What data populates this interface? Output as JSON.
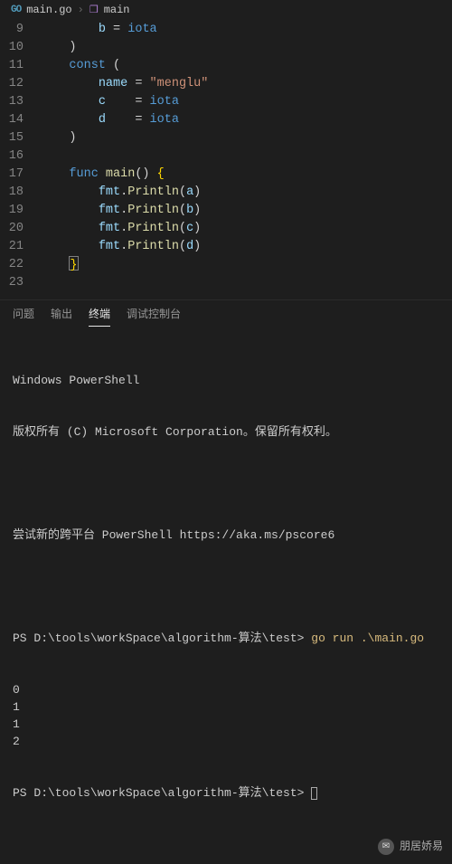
{
  "breadcrumb": {
    "file": "main.go",
    "symbol": "main"
  },
  "code_lines": [
    {
      "n": 9,
      "html": "        <span class='tok-id'>b</span> <span class='tok-punc'>=</span> <span class='tok-iota'>iota</span>"
    },
    {
      "n": 10,
      "html": "    <span class='tok-punc'>)</span>"
    },
    {
      "n": 11,
      "html": "    <span class='tok-kw'>const</span> <span class='tok-punc'>(</span>"
    },
    {
      "n": 12,
      "html": "        <span class='tok-id'>name</span> <span class='tok-punc'>=</span> <span class='tok-str'>\"menglu\"</span>"
    },
    {
      "n": 13,
      "html": "        <span class='tok-id'>c</span>    <span class='tok-punc'>=</span> <span class='tok-iota'>iota</span>"
    },
    {
      "n": 14,
      "html": "        <span class='tok-id'>d</span>    <span class='tok-punc'>=</span> <span class='tok-iota'>iota</span>"
    },
    {
      "n": 15,
      "html": "    <span class='tok-punc'>)</span>"
    },
    {
      "n": 16,
      "html": ""
    },
    {
      "n": 17,
      "html": "    <span class='tok-kw'>func</span> <span class='tok-func'>main</span><span class='tok-punc'>()</span> <span class='tok-brace'>{</span>"
    },
    {
      "n": 18,
      "html": "        <span class='tok-id'>fmt</span><span class='tok-punc'>.</span><span class='tok-func'>Println</span><span class='tok-punc'>(</span><span class='tok-id'>a</span><span class='tok-punc'>)</span>"
    },
    {
      "n": 19,
      "html": "        <span class='tok-id'>fmt</span><span class='tok-punc'>.</span><span class='tok-func'>Println</span><span class='tok-punc'>(</span><span class='tok-id'>b</span><span class='tok-punc'>)</span>"
    },
    {
      "n": 20,
      "html": "        <span class='tok-id'>fmt</span><span class='tok-punc'>.</span><span class='tok-func'>Println</span><span class='tok-punc'>(</span><span class='tok-id'>c</span><span class='tok-punc'>)</span>"
    },
    {
      "n": 21,
      "html": "        <span class='tok-id'>fmt</span><span class='tok-punc'>.</span><span class='tok-func'>Println</span><span class='tok-punc'>(</span><span class='tok-id'>d</span><span class='tok-punc'>)</span>"
    },
    {
      "n": 22,
      "html": "    <span class='cursor-box'><span class='tok-brace'>}</span></span>"
    },
    {
      "n": 23,
      "html": ""
    }
  ],
  "panel": {
    "tabs": [
      "问题",
      "输出",
      "终端",
      "调试控制台"
    ],
    "active": 2
  },
  "terminal": {
    "line1": "Windows PowerShell",
    "line2": "版权所有 (C) Microsoft Corporation。保留所有权利。",
    "line3": "尝试新的跨平台 PowerShell https://aka.ms/pscore6",
    "prompt_path": "PS D:\\tools\\workSpace\\algorithm-算法\\test>",
    "command": "go run .\\main.go",
    "output": [
      "0",
      "1",
      "1",
      "2"
    ],
    "prompt2": "PS D:\\tools\\workSpace\\algorithm-算法\\test>"
  },
  "watermark": {
    "text": "朋居娇易"
  }
}
